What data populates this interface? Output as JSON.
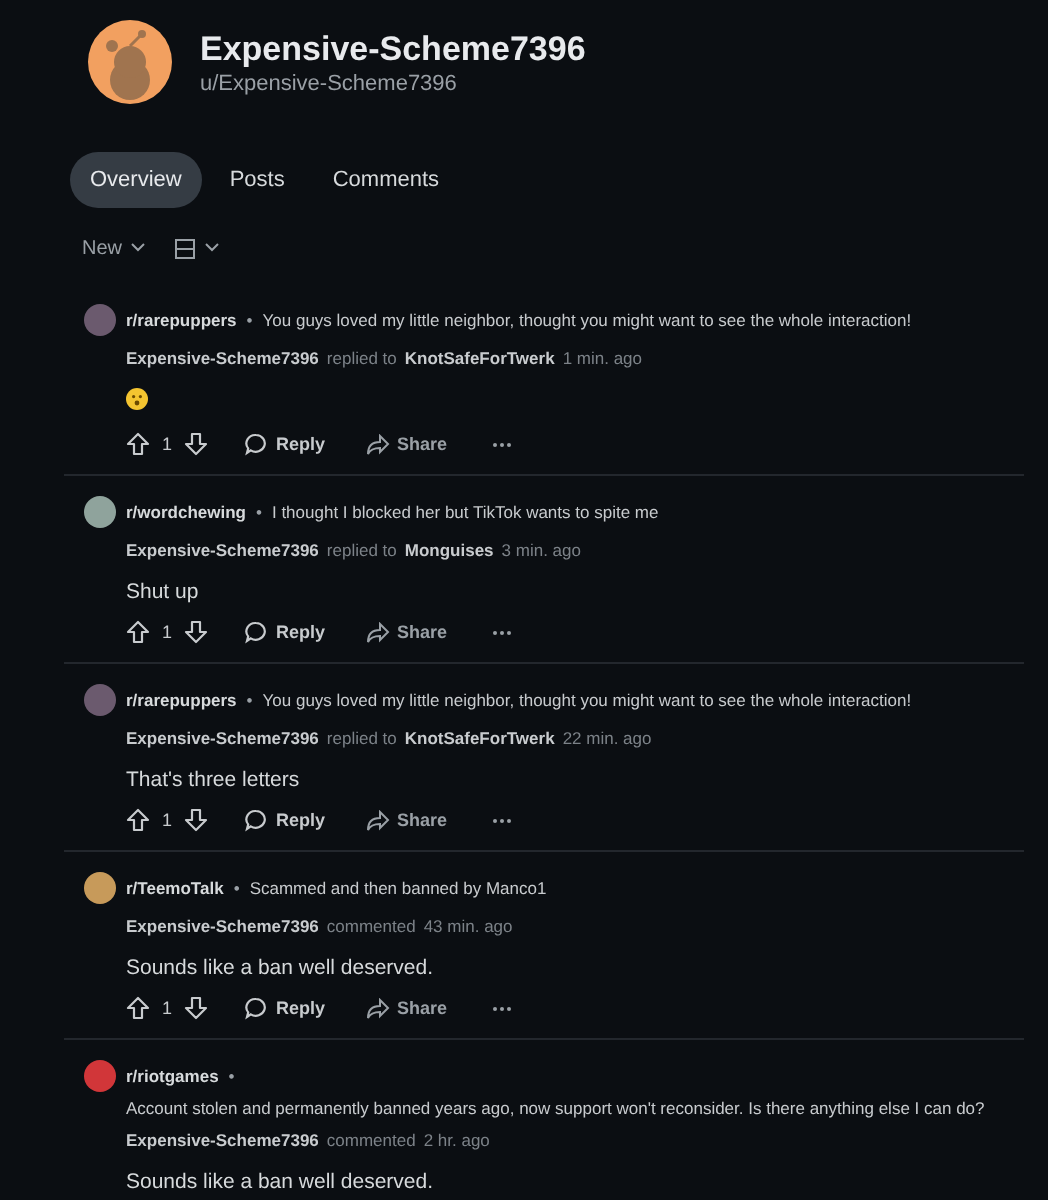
{
  "profile": {
    "display_name": "Expensive-Scheme7396",
    "username": "u/Expensive-Scheme7396"
  },
  "tabs": [
    {
      "label": "Overview",
      "selected": true
    },
    {
      "label": "Posts",
      "selected": false
    },
    {
      "label": "Comments",
      "selected": false
    }
  ],
  "sort": {
    "label": "New"
  },
  "comments": [
    {
      "subreddit": "r/rarepuppers",
      "color": "#6b5a6e",
      "separator": "•",
      "post_title": "You guys loved my little neighbor, thought you might want to see the whole interaction!",
      "author": "Expensive-Scheme7396",
      "action": "replied to",
      "target": "KnotSafeForTwerk",
      "time": "1 min. ago",
      "kind": "emoji",
      "votes": "1",
      "reply": "Reply",
      "share": "Share"
    },
    {
      "subreddit": "r/wordchewing",
      "color": "#8fa39c",
      "separator": "•",
      "post_title": "I thought I blocked her but TikTok wants to spite me",
      "author": "Expensive-Scheme7396",
      "action": "replied to",
      "target": "Monguises",
      "time": "3 min. ago",
      "kind": "text",
      "body": "Shut up",
      "votes": "1",
      "reply": "Reply",
      "share": "Share"
    },
    {
      "subreddit": "r/rarepuppers",
      "color": "#6b5a6e",
      "separator": "•",
      "post_title": "You guys loved my little neighbor, thought you might want to see the whole interaction!",
      "author": "Expensive-Scheme7396",
      "action": "replied to",
      "target": "KnotSafeForTwerk",
      "time": "22 min. ago",
      "kind": "text",
      "body": "That's three letters",
      "votes": "1",
      "reply": "Reply",
      "share": "Share"
    },
    {
      "subreddit": "r/TeemoTalk",
      "color": "#c79a5a",
      "separator": "•",
      "post_title": "Scammed and then banned by Manco1",
      "author": "Expensive-Scheme7396",
      "action": "commented",
      "time": "43 min. ago",
      "kind": "text",
      "body": "Sounds like a ban well deserved.",
      "votes": "1",
      "reply": "Reply",
      "share": "Share"
    },
    {
      "subreddit": "r/riotgames",
      "color": "#d13639",
      "separator": "•",
      "post_title_below": "Account stolen and permanently banned years ago, now support won't reconsider. Is there anything else I can do?",
      "author": "Expensive-Scheme7396",
      "action": "commented",
      "time": "2 hr. ago",
      "kind": "text",
      "body": "Sounds like a ban well deserved."
    }
  ]
}
